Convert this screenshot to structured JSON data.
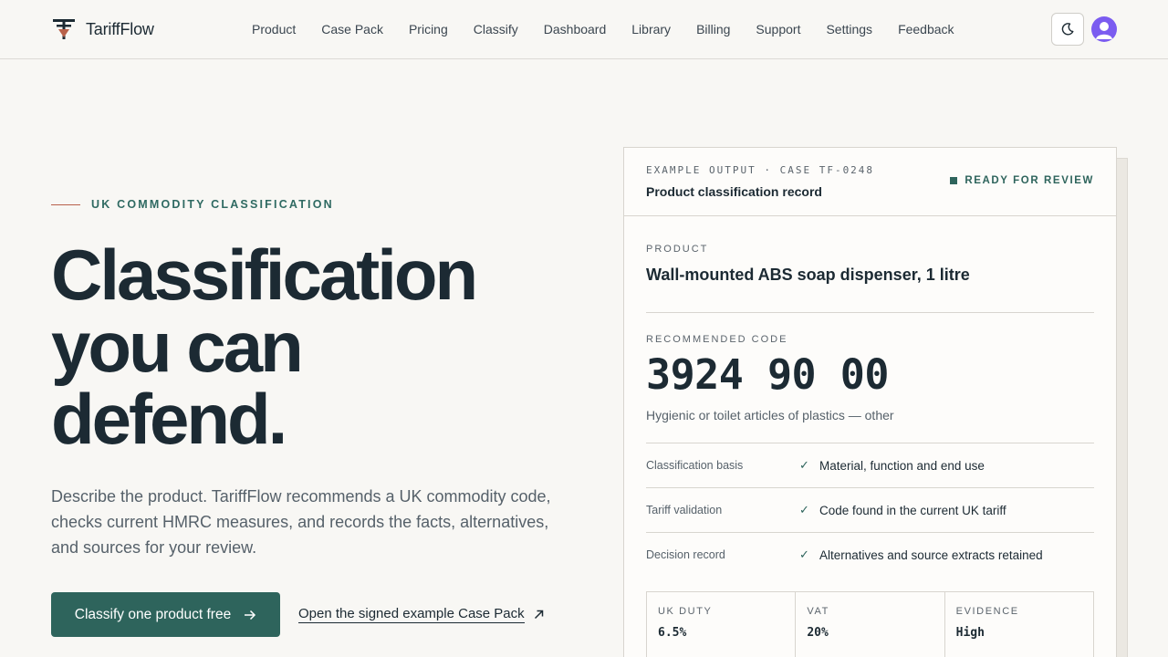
{
  "brand": {
    "name": "TariffFlow"
  },
  "nav": {
    "items": [
      "Product",
      "Case Pack",
      "Pricing",
      "Classify",
      "Dashboard",
      "Library",
      "Billing",
      "Support",
      "Settings",
      "Feedback"
    ]
  },
  "hero": {
    "eyebrow": "UK COMMODITY CLASSIFICATION",
    "headline": [
      "Classification",
      "you can",
      "defend."
    ],
    "lede": "Describe the product. TariffFlow recommends a UK commodity code, checks current HMRC measures, and records the facts, alternatives, and sources for your review.",
    "cta_label": "Classify one product free",
    "secondary_link": "Open the signed example Case Pack"
  },
  "card": {
    "eyebrow": "EXAMPLE OUTPUT · CASE TF-0248",
    "title": "Product classification record",
    "status": "READY FOR REVIEW",
    "product_label": "PRODUCT",
    "product_name": "Wall-mounted ABS soap dispenser, 1 litre",
    "code_label": "RECOMMENDED CODE",
    "code": "3924 90 00",
    "code_description": "Hygienic or toilet articles of plastics — other",
    "checks": [
      {
        "key": "Classification basis",
        "value": "Material, function and end use"
      },
      {
        "key": "Tariff validation",
        "value": "Code found in the current UK tariff"
      },
      {
        "key": "Decision record",
        "value": "Alternatives and source extracts retained"
      }
    ],
    "stats": [
      {
        "label": "UK DUTY",
        "value": "6.5%"
      },
      {
        "label": "VAT",
        "value": "20%"
      },
      {
        "label": "EVIDENCE",
        "value": "High"
      }
    ]
  },
  "colors": {
    "accent": "#2e645c",
    "eyebrow_rule": "#b8614a",
    "avatar": "#7b5cf0"
  }
}
